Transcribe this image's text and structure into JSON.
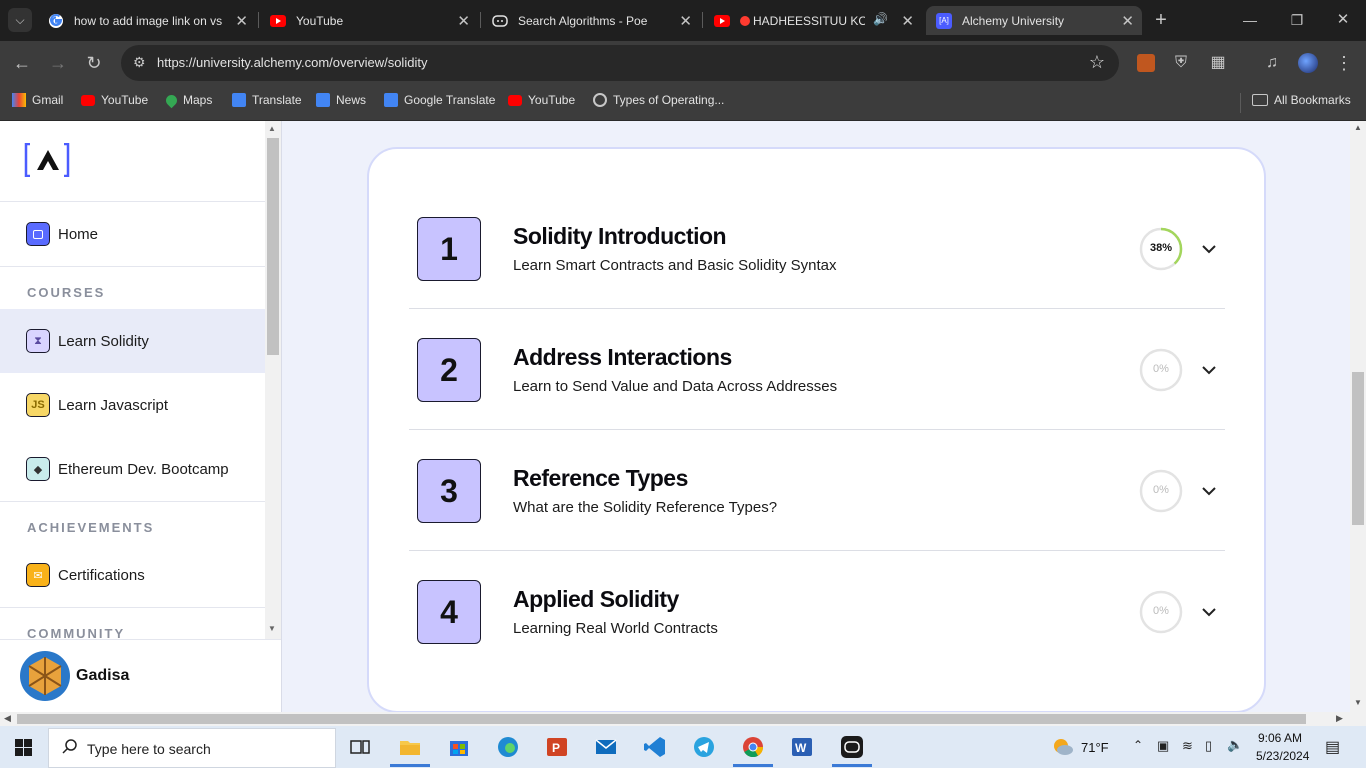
{
  "browser": {
    "tabs": [
      {
        "title": "how to add image link on vs",
        "active": false
      },
      {
        "title": "YouTube",
        "active": false
      },
      {
        "title": "Search Algorithms - Poe",
        "active": false
      },
      {
        "title": "HADHEESSITUU KOO",
        "active": false
      },
      {
        "title": "Alchemy University",
        "active": true
      }
    ],
    "url": "https://university.alchemy.com/overview/solidity",
    "bookmarks": [
      "Gmail",
      "YouTube",
      "Maps",
      "Translate",
      "News",
      "Google Translate",
      "YouTube",
      "Types of Operating..."
    ],
    "all_bookmarks": "All Bookmarks"
  },
  "sidebar": {
    "home": "Home",
    "courses_label": "COURSES",
    "courses": [
      "Learn Solidity",
      "Learn Javascript",
      "Ethereum Dev. Bootcamp"
    ],
    "achievements_label": "ACHIEVEMENTS",
    "certifications": "Certifications",
    "community_label": "COMMUNITY",
    "user_name": "Gadisa"
  },
  "lessons": [
    {
      "number": "1",
      "title": "Solidity Introduction",
      "subtitle": "Learn Smart Contracts and Basic Solidity Syntax",
      "progress_label": "38%",
      "progress": 38
    },
    {
      "number": "2",
      "title": "Address Interactions",
      "subtitle": "Learn to Send Value and Data Across Addresses",
      "progress_label": "0%",
      "progress": 0
    },
    {
      "number": "3",
      "title": "Reference Types",
      "subtitle": "What are the Solidity Reference Types?",
      "progress_label": "0%",
      "progress": 0
    },
    {
      "number": "4",
      "title": "Applied Solidity",
      "subtitle": "Learning Real World Contracts",
      "progress_label": "0%",
      "progress": 0
    }
  ],
  "taskbar": {
    "search_placeholder": "Type here to search",
    "weather": "71°F",
    "time": "9:06 AM",
    "date": "5/23/2024"
  },
  "colors": {
    "accent": "#c8c3ff",
    "progress": "#a3d65c",
    "brand": "#3d4bff"
  }
}
